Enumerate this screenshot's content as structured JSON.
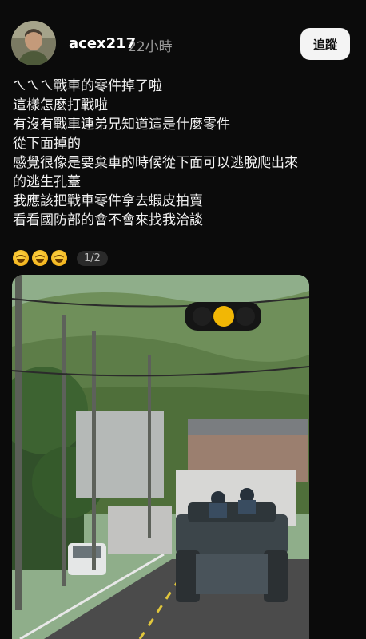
{
  "header": {
    "username": "acex217",
    "time": "22小時",
    "follow_label": "追蹤"
  },
  "post": {
    "lines": [
      "ㄟㄟㄟ戰車的零件掉了啦",
      "這樣怎麼打戰啦",
      "有沒有戰車連弟兄知道這是什麼零件",
      "從下面掉的",
      "感覺很像是要棄車的時候從下面可以逃脫爬出來",
      "的逃生孔蓋",
      "我應該把戰車零件拿去蝦皮拍賣",
      "看看國防部的會不會來找我洽談"
    ],
    "emoji_count": 3,
    "emoji_icon": "rolling-on-floor-laughing-emoji",
    "page_indicator": "1/2"
  },
  "media": {
    "description_icon": "photo-tank-on-road",
    "traffic_light_color": "#f2b705"
  }
}
